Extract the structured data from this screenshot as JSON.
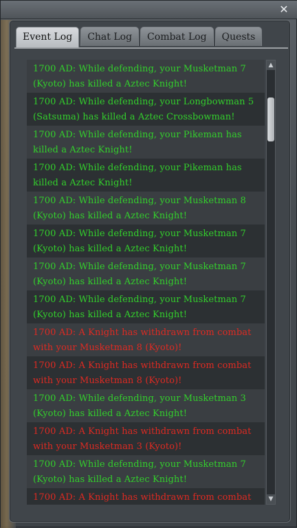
{
  "window": {
    "close_glyph": "✕"
  },
  "tabs": [
    {
      "label": "Event Log",
      "active": true
    },
    {
      "label": "Chat Log",
      "active": false
    },
    {
      "label": "Combat Log",
      "active": false
    },
    {
      "label": "Quests",
      "active": false
    }
  ],
  "log": {
    "entries": [
      {
        "text": "1700 AD: While defending, your Musketman 7 (Kyoto) has killed a Aztec Knight!",
        "color": "green"
      },
      {
        "text": "1700 AD: While defending, your Longbowman 5 (Satsuma) has killed a Aztec Crossbowman!",
        "color": "green"
      },
      {
        "text": "1700 AD: While defending, your Pikeman has killed a Aztec Knight!",
        "color": "green"
      },
      {
        "text": "1700 AD: While defending, your Pikeman has killed a Aztec Knight!",
        "color": "green"
      },
      {
        "text": "1700 AD: While defending, your Musketman 8 (Kyoto) has killed a Aztec Knight!",
        "color": "green"
      },
      {
        "text": "1700 AD: While defending, your Musketman 7 (Kyoto) has killed a Aztec Knight!",
        "color": "green"
      },
      {
        "text": "1700 AD: While defending, your Musketman 7 (Kyoto) has killed a Aztec Knight!",
        "color": "green"
      },
      {
        "text": "1700 AD: While defending, your Musketman 7 (Kyoto) has killed a Aztec Knight!",
        "color": "green"
      },
      {
        "text": "1700 AD: A Knight has withdrawn from combat with your Musketman 8 (Kyoto)!",
        "color": "red"
      },
      {
        "text": "1700 AD: A Knight has withdrawn from combat with your Musketman 8 (Kyoto)!",
        "color": "red"
      },
      {
        "text": "1700 AD: While defending, your Musketman 3 (Kyoto) has killed a Aztec Knight!",
        "color": "green"
      },
      {
        "text": "1700 AD: A Knight has withdrawn from combat with your Musketman 3 (Kyoto)!",
        "color": "red"
      },
      {
        "text": "1700 AD: While defending, your Musketman 7 (Kyoto) has killed a Aztec Knight!",
        "color": "green"
      },
      {
        "text": "1700 AD: A Knight has withdrawn from combat",
        "color": "red"
      }
    ],
    "colors": {
      "green": "#33d12c",
      "red": "#e02a22"
    }
  },
  "scrollbar": {
    "up_glyph": "▲",
    "down_glyph": "▼"
  }
}
